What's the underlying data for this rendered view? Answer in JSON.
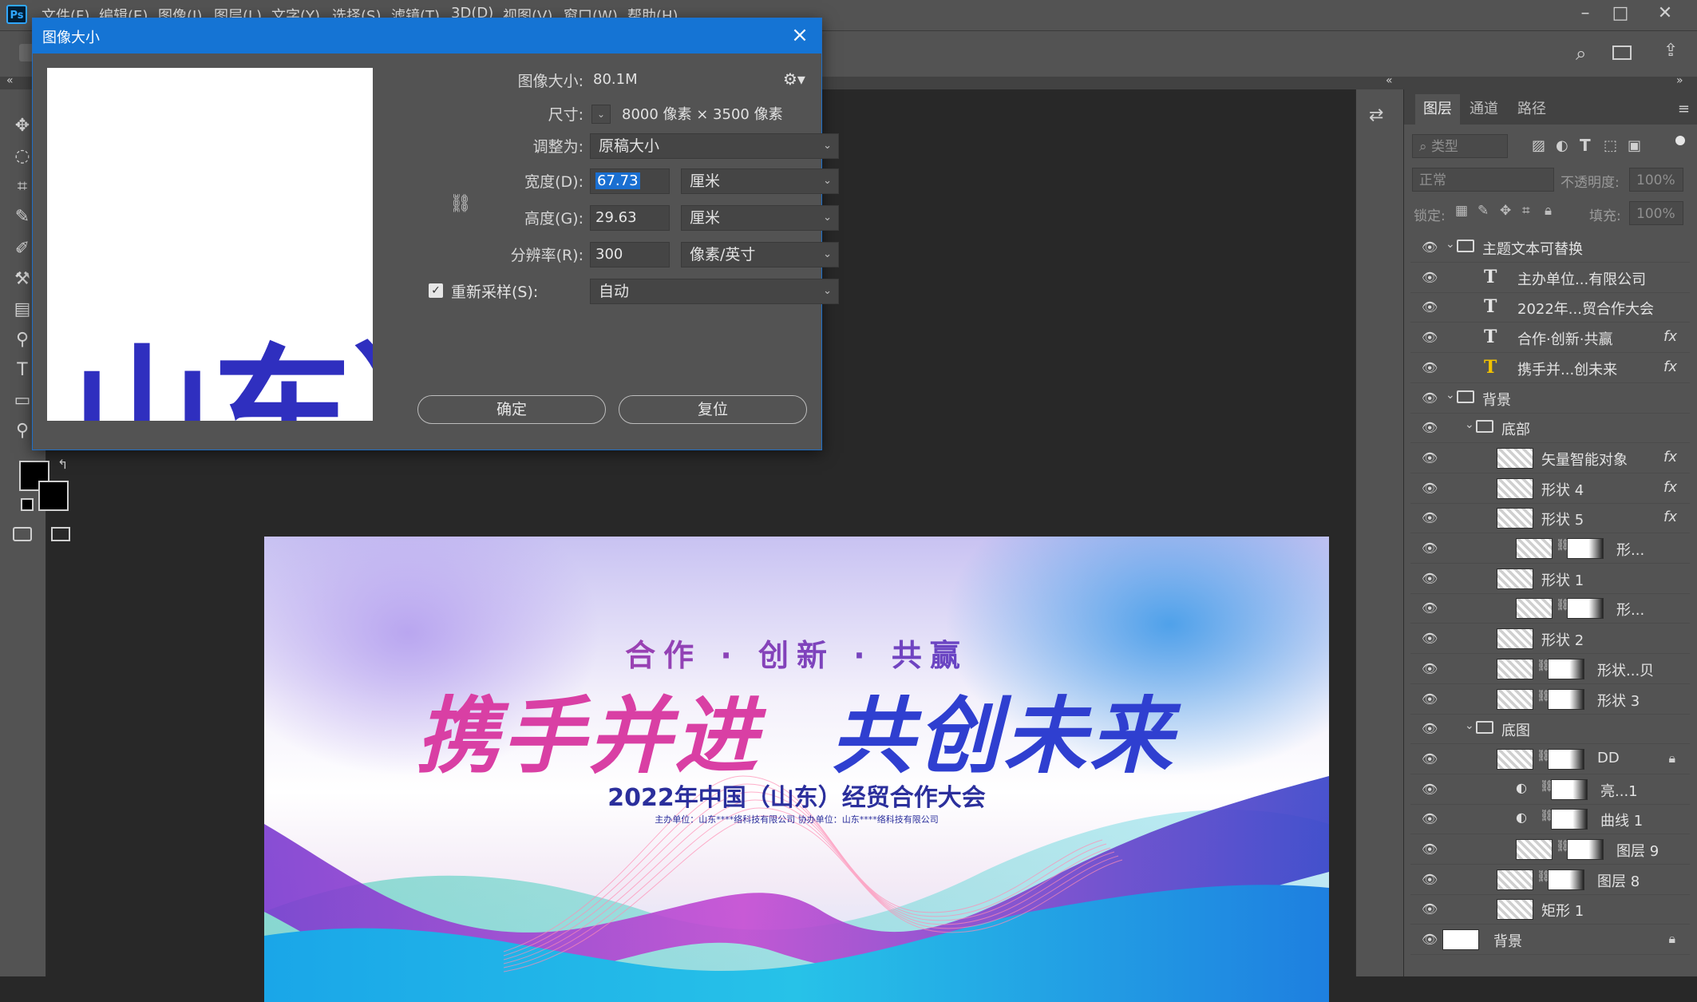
{
  "app": {
    "logo": "Ps",
    "menus": [
      "文件(F)",
      "编辑(E)",
      "图像(I)",
      "图层(L)",
      "文字(Y)",
      "选择(S)",
      "滤镜(T)",
      "3D(D)",
      "视图(V)",
      "窗口(W)",
      "帮助(H)"
    ]
  },
  "dialog": {
    "title": "图像大小",
    "image_size_label": "图像大小:",
    "image_size_value": "80.1M",
    "dimensions_label": "尺寸:",
    "dimensions_value": "8000 像素  ×  3500 像素",
    "fit_to_label": "调整为:",
    "fit_to_value": "原稿大小",
    "width_label": "宽度(D):",
    "width_value": "67.73",
    "width_unit": "厘米",
    "height_label": "高度(G):",
    "height_value": "29.63",
    "height_unit": "厘米",
    "resolution_label": "分辨率(R):",
    "resolution_value": "300",
    "resolution_unit": "像素/英寸",
    "resample_label": "重新采样(S):",
    "resample_checked": true,
    "resample_value": "自动",
    "ok_label": "确定",
    "reset_label": "复位",
    "preview_text": "山东）"
  },
  "artwork": {
    "tagline": "合作 · 创新 · 共赢",
    "headline_left": "携手并进",
    "headline_right": "共创未来",
    "subtitle": "2022年中国（山东）经贸合作大会",
    "organizers": "主办单位：山东****络科技有限公司    协办单位：山东****络科技有限公司"
  },
  "layers_panel": {
    "tabs": [
      "图层",
      "通道",
      "路径"
    ],
    "filter_placeholder": "类型",
    "blend_mode": "正常",
    "opacity_label": "不透明度:",
    "opacity_value": "100%",
    "lock_label": "锁定:",
    "fill_label": "填充:",
    "fill_value": "100%",
    "layers": [
      {
        "name": "主题文本可替换",
        "kind": "group",
        "indent": 0,
        "open": true
      },
      {
        "name": "主办单位...有限公司",
        "kind": "text",
        "indent": 1
      },
      {
        "name": "2022年...贸合作大会",
        "kind": "text",
        "indent": 1
      },
      {
        "name": "合作·创新·共赢",
        "kind": "text",
        "indent": 1,
        "fx": true
      },
      {
        "name": "携手并...创未来",
        "kind": "text-warn",
        "indent": 1,
        "fx": true
      },
      {
        "name": "背景",
        "kind": "group",
        "indent": 0,
        "open": true
      },
      {
        "name": "底部",
        "kind": "group",
        "indent": 1,
        "open": true
      },
      {
        "name": "矢量智能对象",
        "kind": "smart",
        "indent": 2,
        "fx": true
      },
      {
        "name": "形状 4",
        "kind": "shape",
        "indent": 2,
        "fx": true
      },
      {
        "name": "形状 5",
        "kind": "shape",
        "indent": 2,
        "fx": true
      },
      {
        "name": "形...",
        "kind": "shape-mask",
        "indent": 3
      },
      {
        "name": "形状 1",
        "kind": "shape",
        "indent": 2
      },
      {
        "name": "形...",
        "kind": "shape-mask",
        "indent": 3
      },
      {
        "name": "形状 2",
        "kind": "shape",
        "indent": 2
      },
      {
        "name": "形状...贝",
        "kind": "shape-mask",
        "indent": 2
      },
      {
        "name": "形状 3",
        "kind": "shape-mask",
        "indent": 2
      },
      {
        "name": "底图",
        "kind": "group",
        "indent": 1,
        "open": true
      },
      {
        "name": "DD",
        "kind": "pixel-mask",
        "indent": 2,
        "locked": true
      },
      {
        "name": "亮...1",
        "kind": "adjust",
        "indent": 3
      },
      {
        "name": "曲线 1",
        "kind": "adjust",
        "indent": 3
      },
      {
        "name": "图层 9",
        "kind": "pixel-mask",
        "indent": 3
      },
      {
        "name": "图层 8",
        "kind": "pixel-mask",
        "indent": 2
      },
      {
        "name": "矩形 1",
        "kind": "shape",
        "indent": 2
      },
      {
        "name": "背景",
        "kind": "background",
        "indent": 0,
        "locked": true
      }
    ]
  },
  "colors": {
    "accent": "#1574d4",
    "headline_pink": "#d93fa4",
    "headline_blue": "#2f3fd0"
  }
}
